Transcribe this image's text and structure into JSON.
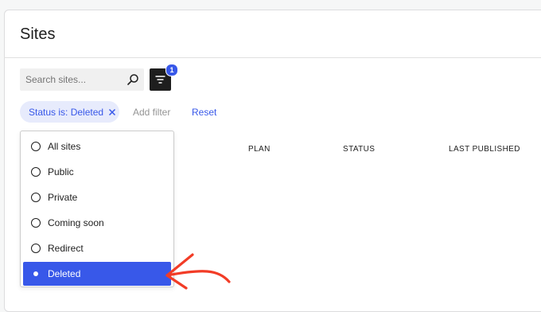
{
  "page": {
    "title": "Sites"
  },
  "search": {
    "placeholder": "Search sites...",
    "value": ""
  },
  "filter_button": {
    "badge_count": "1"
  },
  "active_filter": {
    "label": "Status is: Deleted"
  },
  "toolbar": {
    "add_filter_label": "Add filter",
    "reset_label": "Reset"
  },
  "table": {
    "columns": [
      "PLAN",
      "STATUS",
      "LAST PUBLISHED"
    ]
  },
  "status_dropdown": {
    "options": [
      {
        "label": "All sites",
        "selected": false
      },
      {
        "label": "Public",
        "selected": false
      },
      {
        "label": "Private",
        "selected": false
      },
      {
        "label": "Coming soon",
        "selected": false
      },
      {
        "label": "Redirect",
        "selected": false
      },
      {
        "label": "Deleted",
        "selected": true
      }
    ]
  },
  "colors": {
    "accent": "#3858e9",
    "chip_background": "#e7ebfc",
    "annotation_arrow": "#f23c26",
    "filter_button": "#1e1e1e"
  },
  "icons": {
    "search": "search-icon",
    "filter": "funnel-lines-icon",
    "chip_close": "close-icon",
    "annotation": "hand-drawn-arrow-icon"
  }
}
